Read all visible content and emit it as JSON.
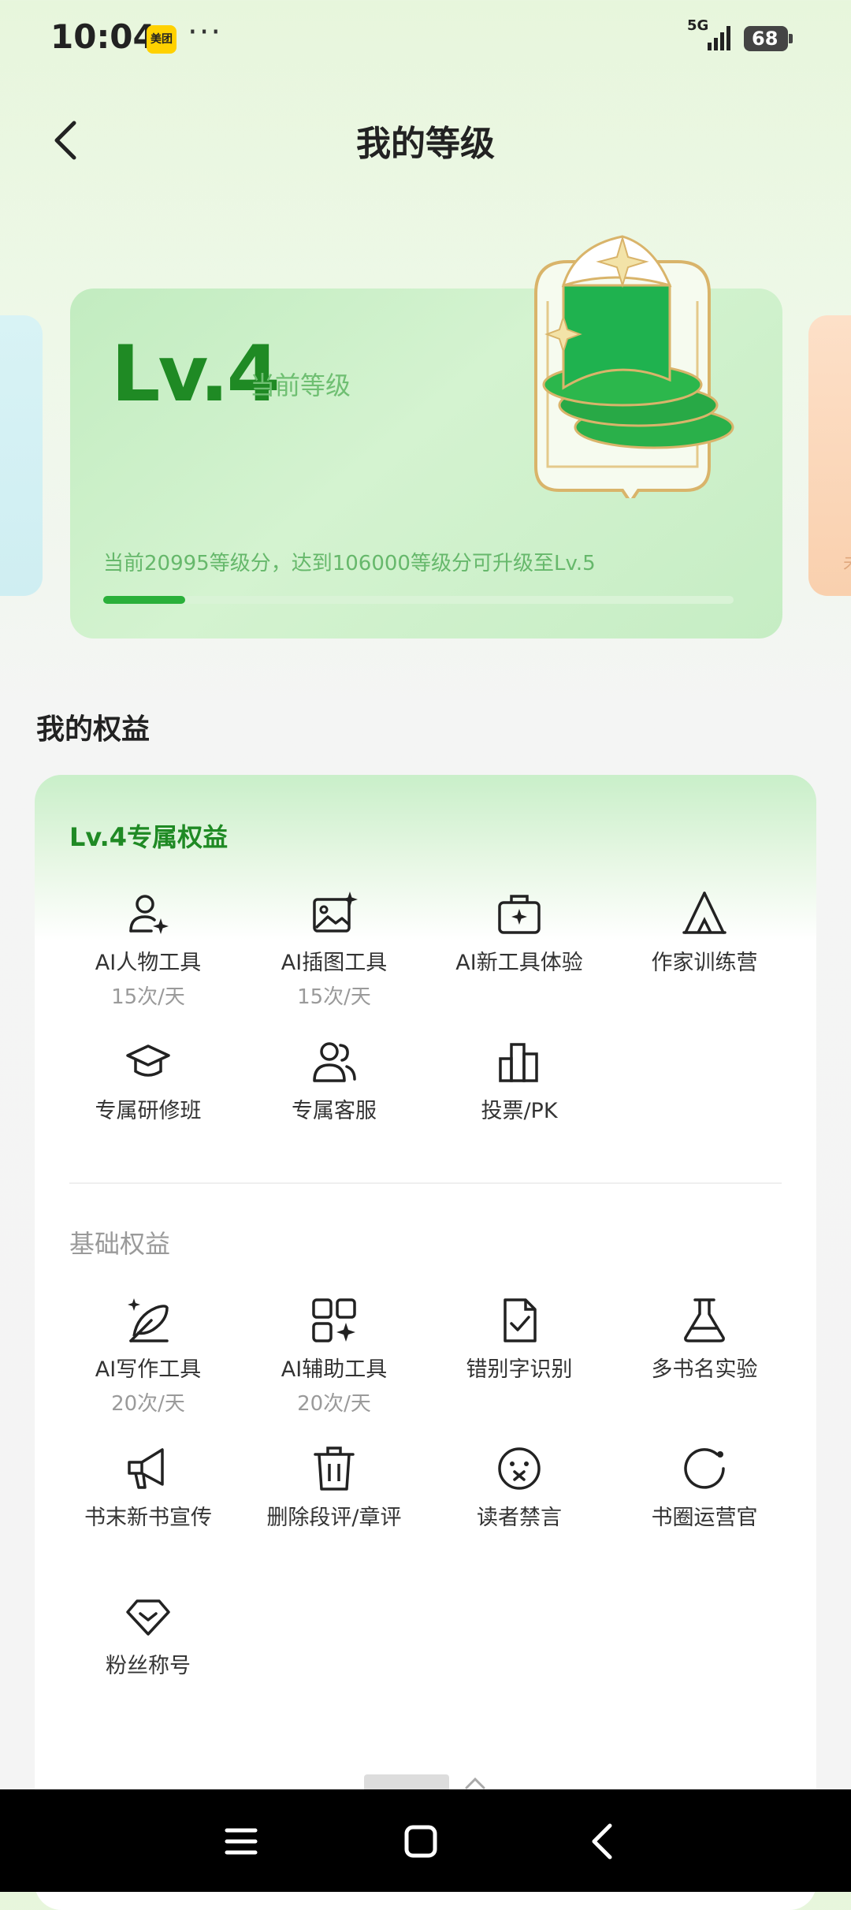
{
  "status_bar": {
    "time": "10:04",
    "app_badge": "美团",
    "more": "···",
    "network": "5G",
    "battery": "68"
  },
  "header": {
    "title": "我的等级"
  },
  "level_card": {
    "level": "Lv.4",
    "level_caption": "当前等级",
    "progress_text": "当前20995等级分，达到106000等级分可升级至Lv.5",
    "current_points": 20995,
    "target_points": 106000,
    "progress_fraction": 0.13,
    "accent_color": "#1f8a24"
  },
  "rights": {
    "section_title": "我的权益",
    "exclusive": {
      "title": "Lv.4专属权益",
      "items": [
        {
          "label": "AI人物工具",
          "sub": "15次/天",
          "icon": "user-plus-sparkle-icon"
        },
        {
          "label": "AI插图工具",
          "sub": "15次/天",
          "icon": "image-sparkle-icon"
        },
        {
          "label": "AI新工具体验",
          "sub": "",
          "icon": "briefcase-sparkle-icon"
        },
        {
          "label": "作家训练营",
          "sub": "",
          "icon": "tent-icon"
        },
        {
          "label": "专属研修班",
          "sub": "",
          "icon": "graduation-cap-icon"
        },
        {
          "label": "专属客服",
          "sub": "",
          "icon": "users-icon"
        },
        {
          "label": "投票/PK",
          "sub": "",
          "icon": "bar-chart-icon"
        }
      ]
    },
    "basic": {
      "title": "基础权益",
      "items": [
        {
          "label": "AI写作工具",
          "sub": "20次/天",
          "icon": "feather-sparkle-icon"
        },
        {
          "label": "AI辅助工具",
          "sub": "20次/天",
          "icon": "grid-sparkle-icon"
        },
        {
          "label": "错别字识别",
          "sub": "",
          "icon": "document-check-icon"
        },
        {
          "label": "多书名实验",
          "sub": "",
          "icon": "flask-icon"
        },
        {
          "label": "书末新书宣传",
          "sub": "",
          "icon": "megaphone-icon"
        },
        {
          "label": "删除段评/章评",
          "sub": "",
          "icon": "trash-icon"
        },
        {
          "label": "读者禁言",
          "sub": "",
          "icon": "mute-face-icon"
        },
        {
          "label": "书圈运营官",
          "sub": "",
          "icon": "circle-refresh-icon"
        },
        {
          "label": "粉丝称号",
          "sub": "",
          "icon": "badge-heart-icon"
        }
      ]
    }
  },
  "nav_bar": {
    "buttons": [
      "menu",
      "home",
      "back"
    ]
  }
}
